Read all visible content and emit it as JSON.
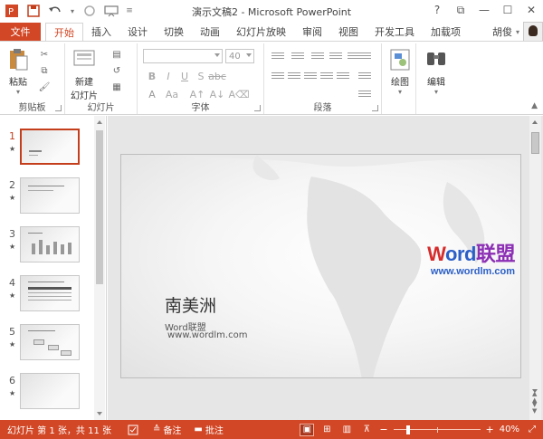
{
  "window": {
    "title": "演示文稿2 - Microsoft PowerPoint",
    "quick_access": [
      "save-icon",
      "undo-icon",
      "redo-icon",
      "customize-icon"
    ],
    "controls": [
      "?",
      "⧉",
      "—",
      "☐",
      "✕"
    ]
  },
  "ribbon_tabs": {
    "file": "文件",
    "tabs": [
      "开始",
      "插入",
      "设计",
      "切换",
      "动画",
      "幻灯片放映",
      "审阅",
      "视图",
      "开发工具",
      "加载项"
    ],
    "active": "开始",
    "user": "胡俊"
  },
  "ribbon": {
    "clipboard": {
      "paste": "粘贴",
      "label": "剪贴板"
    },
    "slides": {
      "new_slide_line1": "新建",
      "new_slide_line2": "幻灯片",
      "label": "幻灯片"
    },
    "font": {
      "font_name": "",
      "font_size": "40",
      "label": "字体"
    },
    "paragraph": {
      "label": "段落"
    },
    "drawing": {
      "label": "绘图"
    },
    "editing": {
      "label": "编辑"
    }
  },
  "thumbnails": [
    {
      "num": "1",
      "active": true,
      "star": "★"
    },
    {
      "num": "2",
      "active": false,
      "star": "★"
    },
    {
      "num": "3",
      "active": false,
      "star": "★"
    },
    {
      "num": "4",
      "active": false,
      "star": "★"
    },
    {
      "num": "5",
      "active": false,
      "star": "★"
    },
    {
      "num": "6",
      "active": false,
      "star": "★"
    }
  ],
  "slide": {
    "title": "南美洲",
    "subtitle": "Word联盟",
    "url": "www.wordlm.com"
  },
  "watermark": {
    "word_part1": "W",
    "word_part2": "ord",
    "word_part3": "联盟",
    "url": "www.wordlm.com"
  },
  "statusbar": {
    "slide_info": "幻灯片 第 1 张，共 11 张",
    "notes": "备注",
    "comments": "批注",
    "zoom": "40%",
    "zoom_level_percent": 40
  },
  "colors": {
    "accent": "#d24726",
    "active_thumb_border": "#c43e1c"
  }
}
